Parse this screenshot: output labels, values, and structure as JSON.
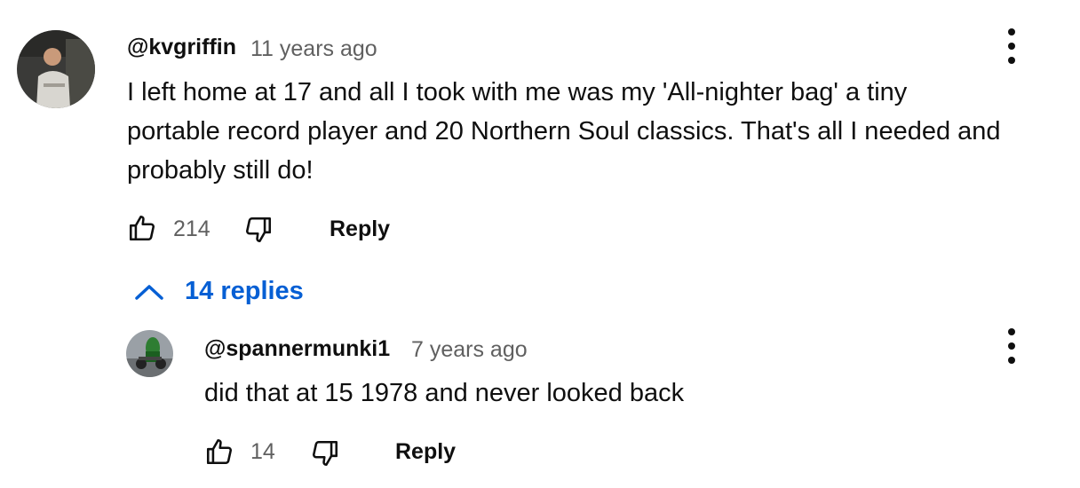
{
  "comment": {
    "author": "@kvgriffin",
    "timestamp": "11 years ago",
    "text_lines": [
      "I left home at 17 and all I took with me was my 'All-nighter bag' a tiny",
      "portable record player and 20 Northern Soul classics. That's all I needed and",
      "probably still do!"
    ],
    "likes": "214",
    "reply_label": "Reply",
    "like_icon": "thumbs-up-icon",
    "dislike_icon": "thumbs-down-icon",
    "menu_icon": "more-vert-icon"
  },
  "replies_toggle": {
    "label": "14 replies",
    "icon": "chevron-up-icon",
    "color": "#065fd4"
  },
  "reply": {
    "author": "@spannermunki1",
    "timestamp": "7 years ago",
    "text": "did that at 15 1978 and never looked back",
    "likes": "14",
    "reply_label": "Reply",
    "like_icon": "thumbs-up-icon",
    "dislike_icon": "thumbs-down-icon",
    "menu_icon": "more-vert-icon"
  }
}
